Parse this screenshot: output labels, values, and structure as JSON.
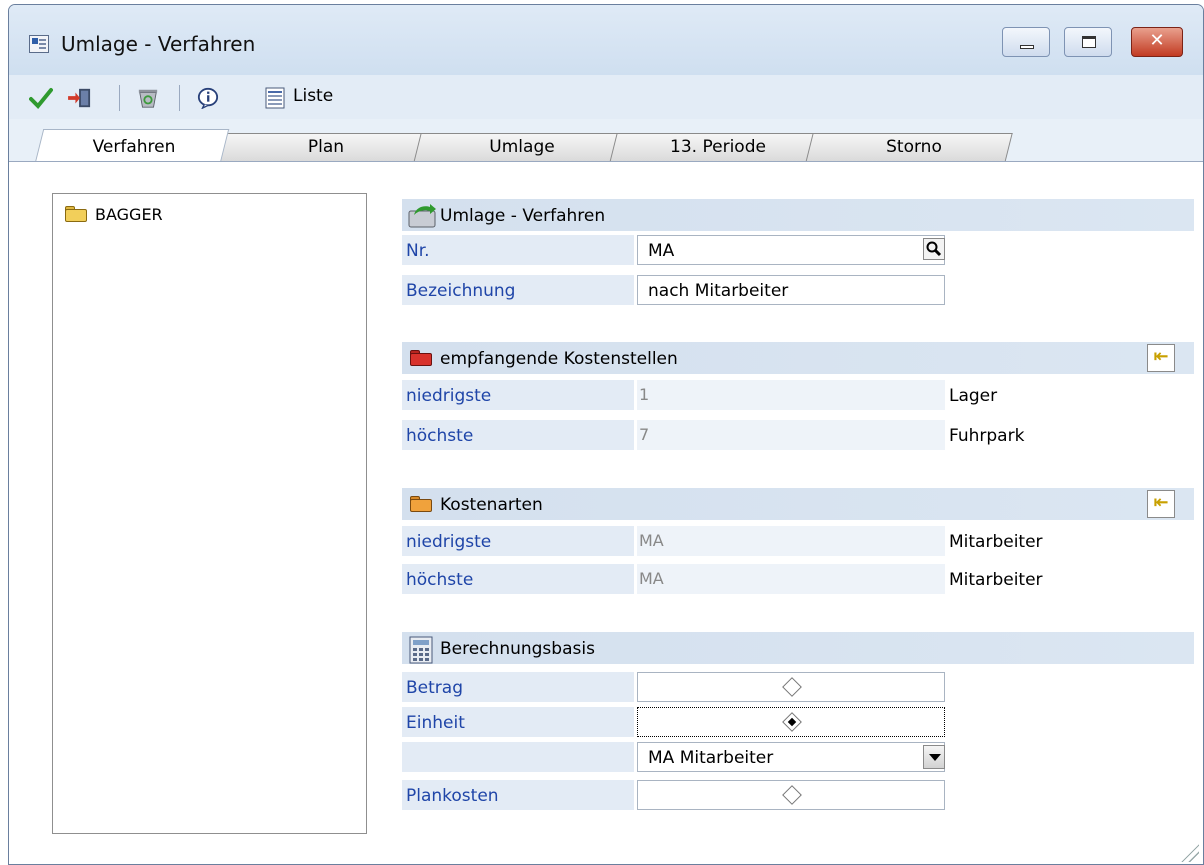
{
  "window": {
    "title": "Umlage - Verfahren"
  },
  "toolbar": {
    "icons": [
      "checkmark-icon",
      "exit-icon",
      "recycle-icon",
      "info-icon",
      "list-icon"
    ],
    "liste_label": "Liste"
  },
  "tabs": [
    {
      "label": "Verfahren",
      "active": true
    },
    {
      "label": "Plan",
      "active": false
    },
    {
      "label": "Umlage",
      "active": false
    },
    {
      "label": "13. Periode",
      "active": false
    },
    {
      "label": "Storno",
      "active": false
    }
  ],
  "tree": {
    "items": [
      {
        "label": "BAGGER"
      }
    ]
  },
  "section_verfahren": {
    "title": "Umlage - Verfahren",
    "nr_label": "Nr.",
    "nr_value": "MA",
    "bezeichnung_label": "Bezeichnung",
    "bezeichnung_value": "nach Mitarbeiter"
  },
  "section_kostenstellen": {
    "title": "empfangende Kostenstellen",
    "niedrigste_label": "niedrigste",
    "niedrigste_value": "1",
    "niedrigste_name": "Lager",
    "hoechste_label": "höchste",
    "hoechste_value": "7",
    "hoechste_name": "Fuhrpark"
  },
  "section_kostenarten": {
    "title": "Kostenarten",
    "niedrigste_label": "niedrigste",
    "niedrigste_value": "MA",
    "niedrigste_name": "Mitarbeiter",
    "hoechste_label": "höchste",
    "hoechste_value": "MA",
    "hoechste_name": "Mitarbeiter"
  },
  "section_basis": {
    "title": "Berechnungsbasis",
    "betrag_label": "Betrag",
    "betrag_checked": false,
    "einheit_label": "Einheit",
    "einheit_checked": true,
    "einheit_select": "MA  Mitarbeiter",
    "plankosten_label": "Plankosten",
    "plankosten_checked": false
  },
  "colors": {
    "label_blue": "#1f45a8",
    "section_bg": "#d4e0ee",
    "folder_yellow": "#f2cf5a",
    "folder_red": "#d8322c",
    "folder_orange": "#f0a23c"
  }
}
